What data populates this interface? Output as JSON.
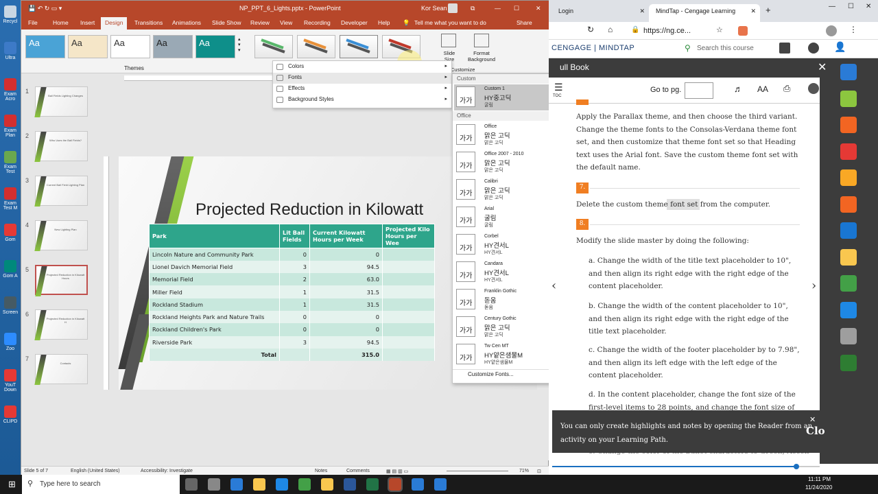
{
  "desktop": {
    "icons": [
      {
        "label": "Recycl",
        "color": "#c9d6e3"
      },
      {
        "label": "Ultra",
        "color": "#3d7ac7"
      },
      {
        "label": "Exam Acro",
        "color": "#d32f2f"
      },
      {
        "label": "Exam Plan",
        "color": "#d32f2f"
      },
      {
        "label": "Exam Test",
        "color": "#6aa84f"
      },
      {
        "label": "Exam Test M",
        "color": "#d32f2f"
      },
      {
        "label": "Gom",
        "color": "#e53935"
      },
      {
        "label": "Gom A",
        "color": "#00897b"
      },
      {
        "label": "Screen",
        "color": "#455a64"
      },
      {
        "label": "Zoo",
        "color": "#2d8cff"
      },
      {
        "label": "YouT Down",
        "color": "#e53935"
      },
      {
        "label": "CLIPD",
        "color": "#e53935"
      }
    ]
  },
  "ppt": {
    "title": "NP_PPT_6_Lights.pptx - PowerPoint",
    "user": "Kor Sean",
    "tabs": [
      "File",
      "Home",
      "Insert",
      "Design",
      "Transitions",
      "Animations",
      "Slide Show",
      "Review",
      "View",
      "Recording",
      "Developer",
      "Help"
    ],
    "tell_me": "Tell me what you want to do",
    "share": "Share",
    "themes_label": "Themes",
    "theme_text": "Aa",
    "customize": {
      "slide_size": "Slide Size",
      "format_background": "Format Background",
      "group": "Customize"
    },
    "variant_menu": [
      {
        "label": "Colors"
      },
      {
        "label": "Fonts"
      },
      {
        "label": "Effects"
      },
      {
        "label": "Background Styles"
      }
    ],
    "slides": [
      {
        "num": "1",
        "title": "Ball Fields Lighting Changes"
      },
      {
        "num": "2",
        "title": "Who Uses the Ball Fields?"
      },
      {
        "num": "3",
        "title": "Current Ball Field Lighting Plan"
      },
      {
        "num": "4",
        "title": "New Lighting Plan"
      },
      {
        "num": "5",
        "title": "Projected Reduction in Kilowatt Hours"
      },
      {
        "num": "6",
        "title": "Projected Reduction in Kilowatt H"
      },
      {
        "num": "7",
        "title": "Contacts"
      }
    ],
    "slide": {
      "title": "Projected Reduction in Kilowatt",
      "headers": [
        "Park",
        "Lit Ball Fields",
        "Current Kilowatt Hours per Week",
        "Projected Kilo Hours per Wee"
      ],
      "rows": [
        [
          "Lincoln Nature and Community Park",
          "0",
          "0"
        ],
        [
          "Lionel Davich Memorial Field",
          "3",
          "94.5"
        ],
        [
          "Memorial Field",
          "2",
          "63.0"
        ],
        [
          "Miller Field",
          "1",
          "31.5"
        ],
        [
          "Rockland Stadium",
          "1",
          "31.5"
        ],
        [
          "Rockland Heights Park and Nature Trails",
          "0",
          "0"
        ],
        [
          "Rockland Children's Park",
          "0",
          "0"
        ],
        [
          "Riverside Park",
          "3",
          "94.5"
        ]
      ],
      "total_label": "Total",
      "total_value": "315.0"
    },
    "fonts_menu": {
      "section_custom": "Custom",
      "section_office": "Office",
      "sample": "가가",
      "customize_link": "Customize Fonts...",
      "items": [
        {
          "name": "Custom 1",
          "heading": "HY중고딕",
          "body": "굴림"
        },
        {
          "name": "Office",
          "heading": "맑은 고딕",
          "body": "맑은 고딕"
        },
        {
          "name": "Office 2007 - 2010",
          "heading": "맑은 고딕",
          "body": "맑은 고딕"
        },
        {
          "name": "Calibri",
          "heading": "맑은 고딕",
          "body": "맑은 고딕"
        },
        {
          "name": "Arial",
          "heading": "굴림",
          "body": "굴림"
        },
        {
          "name": "Corbel",
          "heading": "HY견서L",
          "body": "HY견서L"
        },
        {
          "name": "Candara",
          "heading": "HY견서L",
          "body": "HY견서L"
        },
        {
          "name": "Franklin Gothic",
          "heading": "돋움",
          "body": "돋움"
        },
        {
          "name": "Century Gothic",
          "heading": "맑은 고딕",
          "body": "맑은 고딕"
        },
        {
          "name": "Tw Cen MT",
          "heading": "HY얕은샘물M",
          "body": "HY얕은샘물M"
        }
      ]
    },
    "status": {
      "slide": "Slide 5 of 7",
      "lang": "English (United States)",
      "access": "Accessibility: Investigate",
      "notes": "Notes",
      "comments": "Comments",
      "zoom": "71%"
    }
  },
  "chrome": {
    "tabs": [
      {
        "label": "Login"
      },
      {
        "label": "MindTap - Cengage Learning"
      }
    ],
    "url": "https://ng.ce...",
    "brand": "CENGAGE | MINDTAP",
    "search_placeholder": "Search this course",
    "book_title": "ull Book",
    "goto": "Go to pg.",
    "toc": "TOC",
    "aa": "AA",
    "steps": [
      {
        "text": "Apply the Parallax theme, and then choose the third variant. Change the theme fonts to the Consolas-Verdana theme font set, and then customize that theme font set so that Heading text uses the Arial font. Save the custom theme font set with the default name."
      },
      {
        "num": "7.",
        "text": "Delete the custom theme font set from the computer."
      },
      {
        "num": "8.",
        "text": "Modify the slide master by doing the following:"
      }
    ],
    "substeps": [
      "a. Change the width of the title text placeholder to 10\", and then align its right edge with the right edge of the content placeholder.",
      "b. Change the width of the content placeholder to 10\", and then align its right edge with the right edge of the title text placeholder.",
      "c. Change the width of the footer placeholder by to 7.98\", and then align its left edge with the left edge of the content placeholder.",
      "d. In the content placeholder, change the font size of the first-level items to 28 points, and change the font size of"
    ],
    "toast": "You can only create highlights and notes by opening the Reader from an activity on your Learning Path.",
    "toast_close": "Clo",
    "hidden_line": "e. Change the color of the bullet characters to Green, Accen"
  },
  "taskbar": {
    "search": "Type here to search",
    "time": "11:11 PM",
    "date": "11/24/2020"
  }
}
